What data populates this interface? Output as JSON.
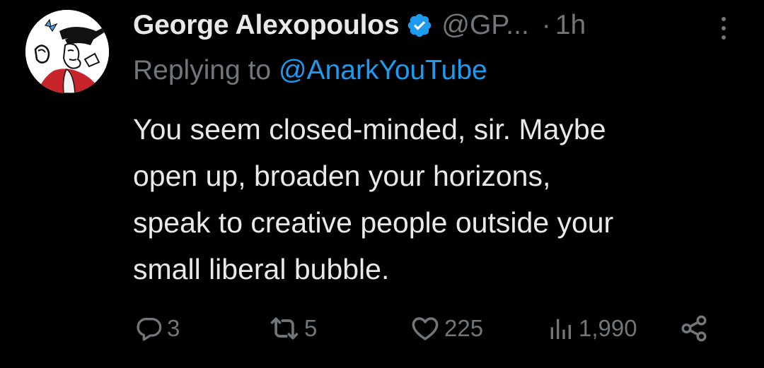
{
  "tweet": {
    "display_name": "George Alexopoulos",
    "handle": "@GP...",
    "separator": "·",
    "time": "1h",
    "replying_prefix": "Replying to",
    "replying_to": "@AnarkYouTube",
    "text_lines": [
      "You seem closed-minded, sir. Maybe",
      "open up, broaden your horizons,",
      "speak to creative people outside your",
      "small liberal bubble."
    ],
    "icons": {
      "verified": "verified-badge-icon",
      "more": "more-options-icon",
      "reply": "reply-icon",
      "repost": "repost-icon",
      "like": "heart-icon",
      "views": "analytics-icon",
      "share": "share-icon"
    },
    "colors": {
      "background": "#000000",
      "primary_text": "#e7e9ea",
      "secondary_text": "#71767b",
      "accent": "#1d9bf0"
    }
  },
  "actions": {
    "replies": "3",
    "reposts": "5",
    "likes": "225",
    "views": "1,990"
  }
}
